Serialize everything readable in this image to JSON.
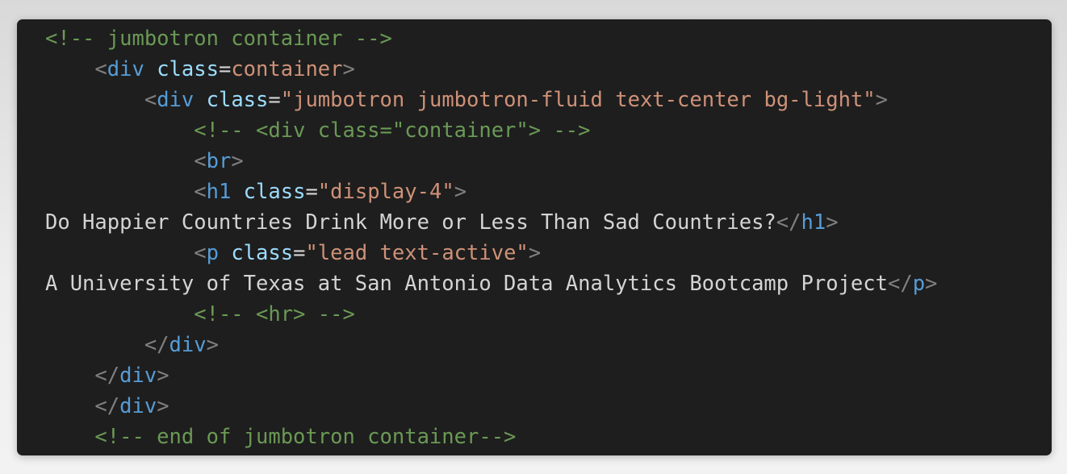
{
  "lines": [
    {
      "indent": "",
      "parts": [
        {
          "t": "cm",
          "v": "<!-- jumbotron container -->"
        }
      ]
    },
    {
      "indent": "    ",
      "parts": [
        {
          "t": "br",
          "v": "<"
        },
        {
          "t": "tg",
          "v": "div"
        },
        {
          "t": "tx",
          "v": " "
        },
        {
          "t": "at",
          "v": "class"
        },
        {
          "t": "eq",
          "v": "="
        },
        {
          "t": "st",
          "v": "container"
        },
        {
          "t": "br",
          "v": ">"
        }
      ]
    },
    {
      "indent": "        ",
      "parts": [
        {
          "t": "br",
          "v": "<"
        },
        {
          "t": "tg",
          "v": "div"
        },
        {
          "t": "tx",
          "v": " "
        },
        {
          "t": "at",
          "v": "class"
        },
        {
          "t": "eq",
          "v": "="
        },
        {
          "t": "st",
          "v": "\"jumbotron jumbotron-fluid text-center bg-light\""
        },
        {
          "t": "br",
          "v": ">"
        }
      ]
    },
    {
      "indent": "            ",
      "parts": [
        {
          "t": "cm",
          "v": "<!-- <div class=\"container\"> -->"
        }
      ]
    },
    {
      "indent": "            ",
      "parts": [
        {
          "t": "br",
          "v": "<"
        },
        {
          "t": "tg",
          "v": "br"
        },
        {
          "t": "br",
          "v": ">"
        }
      ]
    },
    {
      "indent": "            ",
      "parts": [
        {
          "t": "br",
          "v": "<"
        },
        {
          "t": "tg",
          "v": "h1"
        },
        {
          "t": "tx",
          "v": " "
        },
        {
          "t": "at",
          "v": "class"
        },
        {
          "t": "eq",
          "v": "="
        },
        {
          "t": "st",
          "v": "\"display-4\""
        },
        {
          "t": "br",
          "v": ">"
        }
      ]
    },
    {
      "indent": "",
      "parts": [
        {
          "t": "tx",
          "v": "Do Happier Countries Drink More or Less Than Sad Countries?"
        },
        {
          "t": "br",
          "v": "</"
        },
        {
          "t": "tg",
          "v": "h1"
        },
        {
          "t": "br",
          "v": ">"
        }
      ]
    },
    {
      "indent": "            ",
      "parts": [
        {
          "t": "br",
          "v": "<"
        },
        {
          "t": "tg",
          "v": "p"
        },
        {
          "t": "tx",
          "v": " "
        },
        {
          "t": "at",
          "v": "class"
        },
        {
          "t": "eq",
          "v": "="
        },
        {
          "t": "st",
          "v": "\"lead text-active\""
        },
        {
          "t": "br",
          "v": ">"
        }
      ]
    },
    {
      "indent": "",
      "parts": [
        {
          "t": "tx",
          "v": "A University of Texas at San Antonio Data Analytics Bootcamp Project"
        },
        {
          "t": "br",
          "v": "</"
        },
        {
          "t": "tg",
          "v": "p"
        },
        {
          "t": "br",
          "v": ">"
        }
      ]
    },
    {
      "indent": "            ",
      "parts": [
        {
          "t": "cm",
          "v": "<!-- <hr> -->"
        }
      ]
    },
    {
      "indent": "        ",
      "parts": [
        {
          "t": "br",
          "v": "</"
        },
        {
          "t": "tg",
          "v": "div"
        },
        {
          "t": "br",
          "v": ">"
        }
      ]
    },
    {
      "indent": "    ",
      "parts": [
        {
          "t": "br",
          "v": "</"
        },
        {
          "t": "tg",
          "v": "div"
        },
        {
          "t": "br",
          "v": ">"
        }
      ]
    },
    {
      "indent": "    ",
      "parts": [
        {
          "t": "br",
          "v": "</"
        },
        {
          "t": "tg",
          "v": "div"
        },
        {
          "t": "br",
          "v": ">"
        }
      ]
    },
    {
      "indent": "    ",
      "parts": [
        {
          "t": "cm",
          "v": "<!-- end of jumbotron container-->"
        }
      ]
    }
  ]
}
